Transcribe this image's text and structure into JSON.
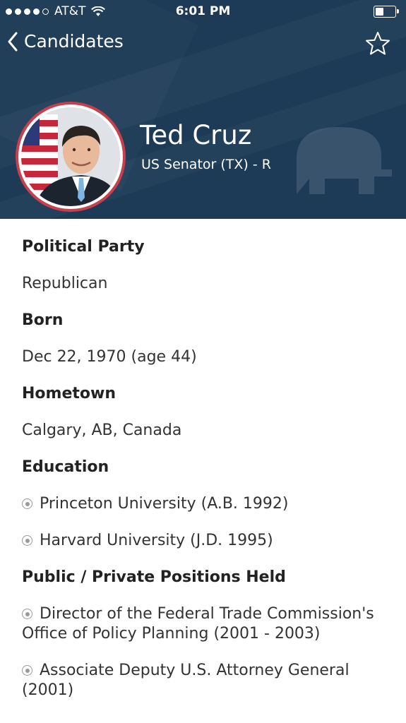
{
  "status_bar": {
    "carrier": "AT&T",
    "time": "6:01 PM"
  },
  "nav": {
    "back_label": "Candidates"
  },
  "candidate": {
    "name": "Ted Cruz",
    "title": "US Senator (TX) - R"
  },
  "details": {
    "political_party": {
      "label": "Political Party",
      "value": "Republican"
    },
    "born": {
      "label": "Born",
      "value": "Dec 22, 1970 (age 44)"
    },
    "hometown": {
      "label": "Hometown",
      "value": "Calgary, AB, Canada"
    },
    "education": {
      "label": "Education",
      "items": [
        "Princeton University (A.B. 1992)",
        "Harvard University (J.D. 1995)"
      ]
    },
    "positions": {
      "label": "Public / Private Positions Held",
      "items": [
        "Director of the Federal Trade Commission's Office of Policy Planning (2001 - 2003)",
        "Associate Deputy U.S. Attorney General (2001)"
      ]
    }
  },
  "colors": {
    "header_bg": "#1d3b57",
    "avatar_ring": "#c8404e"
  }
}
